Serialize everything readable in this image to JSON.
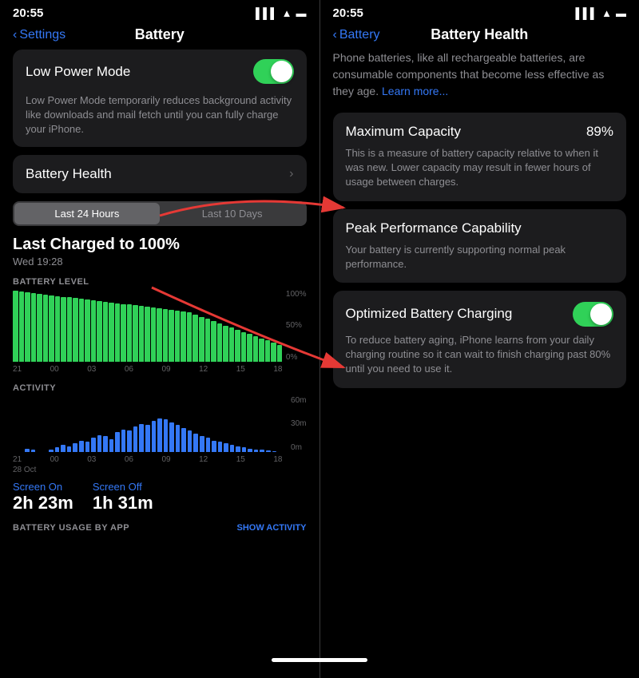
{
  "left_screen": {
    "status_time": "20:55",
    "nav_back": "Settings",
    "nav_title": "Battery",
    "low_power_mode": {
      "label": "Low Power Mode",
      "toggle_state": "on",
      "description": "Low Power Mode temporarily reduces background activity like downloads and mail fetch until you can fully charge your iPhone."
    },
    "battery_health": {
      "label": "Battery Health",
      "chevron": "›"
    },
    "time_selector": {
      "option1": "Last 24 Hours",
      "option2": "Last 10 Days",
      "active": 0
    },
    "last_charged": {
      "title": "Last Charged to 100%",
      "subtitle": "Wed 19:28"
    },
    "battery_level_label": "BATTERY LEVEL",
    "chart_y_labels": [
      "100%",
      "50%",
      "0%"
    ],
    "chart_x_labels": [
      "21",
      "00",
      "03",
      "06",
      "09",
      "12",
      "15",
      "18"
    ],
    "activity_label": "ACTIVITY",
    "activity_y_labels": [
      "60m",
      "30m",
      "0m"
    ],
    "screen_on": {
      "label": "Screen On",
      "value": "2h 23m"
    },
    "screen_off": {
      "label": "Screen Off",
      "value": "1h 31m"
    },
    "battery_usage_label": "BATTERY USAGE BY APP",
    "show_activity": "SHOW ACTIVITY",
    "oct_label": "28 Oct"
  },
  "right_screen": {
    "status_time": "20:55",
    "nav_back": "Battery",
    "nav_title": "Battery Health",
    "intro_text": "Phone batteries, like all rechargeable batteries, are consumable components that become less effective as they age.",
    "learn_more": "Learn more...",
    "maximum_capacity": {
      "label": "Maximum Capacity",
      "value": "89%",
      "description": "This is a measure of battery capacity relative to when it was new. Lower capacity may result in fewer hours of usage between charges."
    },
    "peak_performance": {
      "label": "Peak Performance Capability",
      "description": "Your battery is currently supporting normal peak performance."
    },
    "optimized_charging": {
      "label": "Optimized Battery Charging",
      "toggle_state": "on",
      "description": "To reduce battery aging, iPhone learns from your daily charging routine so it can wait to finish charging past 80% until you need to use it."
    }
  }
}
